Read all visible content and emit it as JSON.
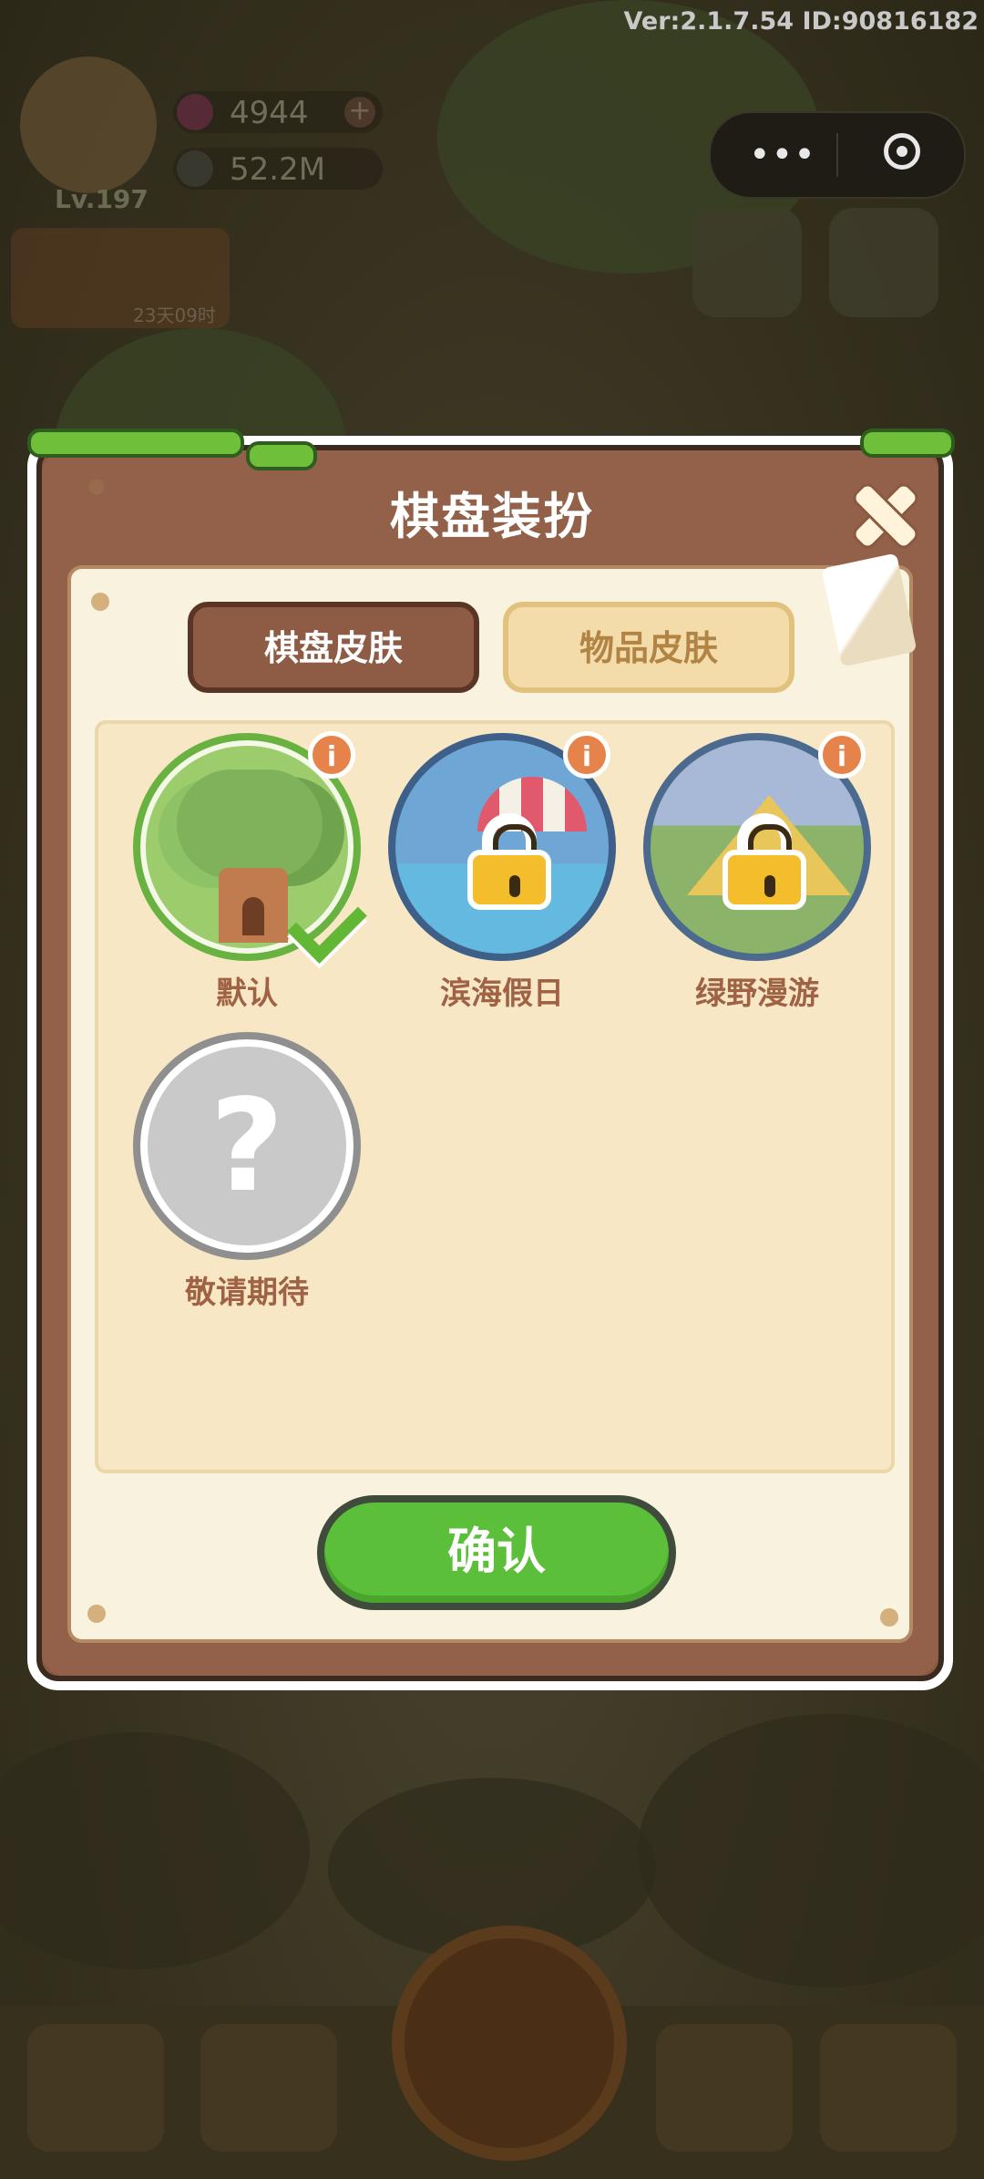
{
  "version_text": "Ver:2.1.7.54 ID:90816182",
  "hud": {
    "level": "Lv.197",
    "gems": "4944",
    "coins": "52.2M",
    "promo_timer": "23天09时"
  },
  "capsule": {
    "more_icon": "more-dots-icon",
    "close_icon": "target-icon"
  },
  "dialog": {
    "title": "棋盘装扮",
    "close_icon": "close-x-icon",
    "tabs": [
      {
        "label": "棋盘皮肤",
        "active": true
      },
      {
        "label": "物品皮肤",
        "active": false
      }
    ],
    "skins": [
      {
        "name": "默认",
        "status": "selected",
        "info": "i"
      },
      {
        "name": "滨海假日",
        "status": "locked",
        "info": "i"
      },
      {
        "name": "绿野漫游",
        "status": "locked",
        "info": "i"
      },
      {
        "name": "敬请期待",
        "status": "coming-soon",
        "placeholder": "?"
      }
    ],
    "confirm_label": "确认"
  },
  "colors": {
    "modal_brown": "#93604a",
    "panel_cream": "#f9f2de",
    "confirm_green": "#5bbf3a",
    "info_orange": "#e6834a",
    "label_brown": "#a06245"
  }
}
